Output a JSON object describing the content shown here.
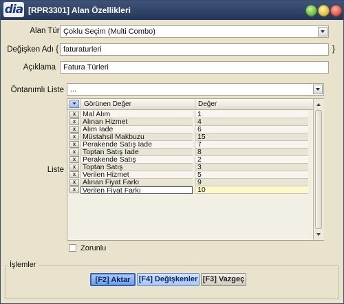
{
  "window": {
    "logo_text": "dia",
    "title": "[RPR3301] Alan Özellikleri",
    "controls": [
      "green-button",
      "yellow-button",
      "red-button"
    ]
  },
  "form": {
    "alan_turu": {
      "label": "Alan Türü",
      "value": "Çoklu Seçim (Multi Combo)"
    },
    "degisken_adi": {
      "label": "Değişken Adı {",
      "value": "faturaturleri",
      "suffix": "}"
    },
    "aciklama": {
      "label": "Açıklama",
      "value": "Fatura Türleri"
    },
    "ontanimli_liste": {
      "label": "Öntanımlı Liste",
      "value": "..."
    },
    "liste": {
      "label": "Liste",
      "columns": [
        "Görünen Değer",
        "Değer"
      ],
      "delete_glyph": "x",
      "rows": [
        {
          "gorunen": "Mal Alım",
          "deger": "1"
        },
        {
          "gorunen": "Alınan Hizmet",
          "deger": "4"
        },
        {
          "gorunen": "Alım İade",
          "deger": "6"
        },
        {
          "gorunen": "Müstahsil Makbuzu",
          "deger": "15"
        },
        {
          "gorunen": "Perakende Satış İade",
          "deger": "7"
        },
        {
          "gorunen": "Toptan Satış İade",
          "deger": "8"
        },
        {
          "gorunen": "Perakende Satış",
          "deger": "2"
        },
        {
          "gorunen": "Toptan Satış",
          "deger": "3"
        },
        {
          "gorunen": "Verilen Hizmet",
          "deger": "5"
        },
        {
          "gorunen": "Alınan Fiyat Farkı",
          "deger": "9"
        },
        {
          "gorunen": "Verilen Fiyat Farkı",
          "deger": "10"
        }
      ],
      "selected_index": 10
    },
    "zorunlu": {
      "label": "Zorunlu",
      "checked": false
    }
  },
  "islemler": {
    "legend": "İşlemler",
    "buttons": {
      "aktar": "[F2] Aktar",
      "degiskenler": "[F4] Değişkenler",
      "vazgec": "[F3] Vazgeç"
    }
  },
  "colors": {
    "titlebar": "#2b3f63",
    "body": "#e9e2cc",
    "primary_button": "#6f9de0",
    "selected_cell": "#fff8c8"
  }
}
